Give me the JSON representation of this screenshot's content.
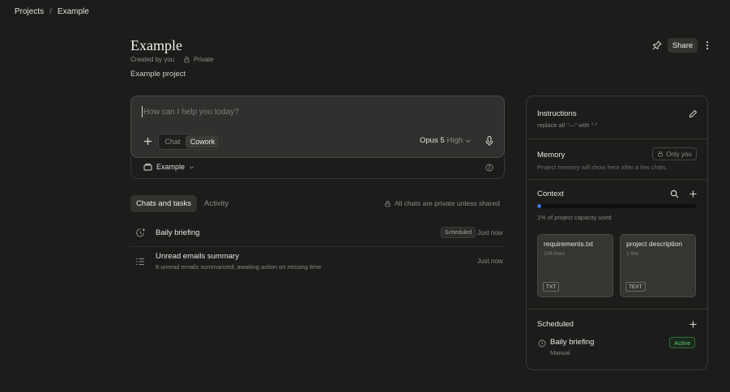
{
  "breadcrumb": {
    "root": "Projects",
    "separator": "/",
    "current": "Example"
  },
  "header": {
    "title": "Example",
    "created_by": "Created by you",
    "meta_separator": "·",
    "visibility": "Private",
    "description": "Example project",
    "share_label": "Share"
  },
  "composer": {
    "placeholder": "How can I help you today?",
    "value": "",
    "modes": [
      "Chat",
      "Cowork"
    ],
    "selected_mode": "Cowork",
    "model": "Opus 5",
    "effort": "High"
  },
  "project_selector": {
    "label": "Example"
  },
  "tabs": {
    "chats": "Chats and tasks",
    "activity": "Activity",
    "active": "Chats and tasks"
  },
  "privacy_note": "All chats are private unless shared",
  "chats": [
    {
      "title": "Baily briefing",
      "subtitle": "",
      "badge": "Scheduled",
      "time": "Just now",
      "icon": "scheduled-task-icon"
    },
    {
      "title": "Unread emails summary",
      "subtitle": "8 unread emails summarized; awaiting action on missing time",
      "badge": "",
      "time": "Just now",
      "icon": "list-icon"
    }
  ],
  "panel": {
    "instructions": {
      "title": "Instructions",
      "text": "replace all \"—\" with \"-\""
    },
    "memory": {
      "title": "Memory",
      "badge": "Only you",
      "text": "Project memory will show here after a few chats."
    },
    "context": {
      "title": "Context",
      "capacity_text": "1% of project capacity used",
      "capacity_percent": 1,
      "files": [
        {
          "name": "requirements.txt",
          "lines": "106 lines",
          "type": "TXT"
        },
        {
          "name": "project description",
          "lines": "1 line",
          "type": "TEXT"
        }
      ]
    },
    "scheduled": {
      "title": "Scheduled",
      "items": [
        {
          "title": "Baily briefing",
          "frequency": "Manual",
          "status": "Active"
        }
      ]
    }
  },
  "colors": {
    "background": "#1c1c1b",
    "accent_blue": "#3b74d9",
    "active_green": "#5cc46a"
  }
}
